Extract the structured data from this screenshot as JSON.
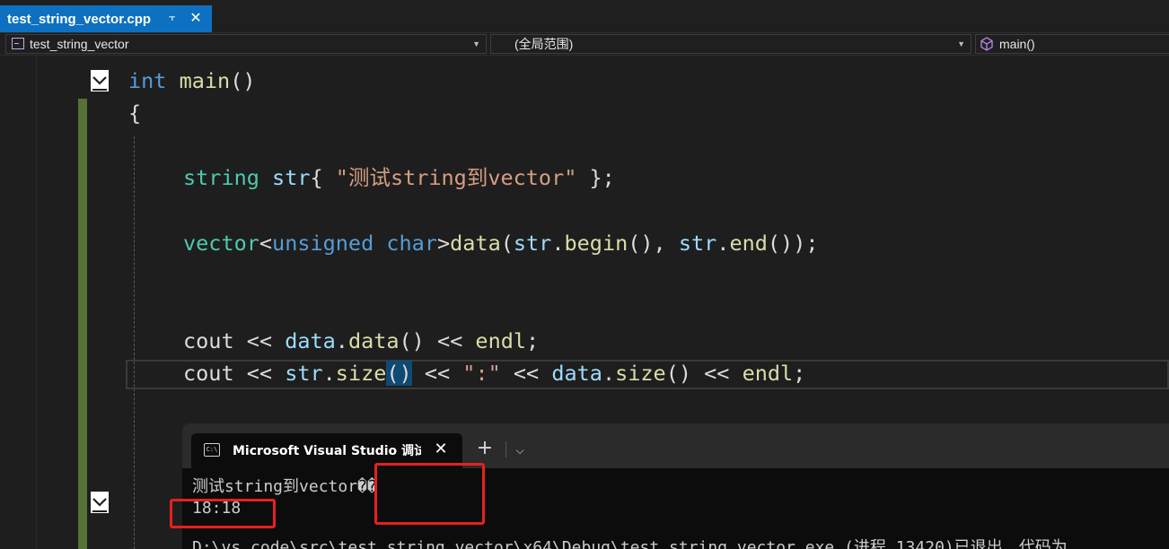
{
  "tab": {
    "title": "test_string_vector.cpp",
    "pin_icon": "pin-icon",
    "close_icon": "close-icon",
    "active_color": "#0e70c0"
  },
  "navbar": {
    "project": "test_string_vector",
    "scope": "(全局范围)",
    "member": "main()"
  },
  "code": {
    "line_main": {
      "kw": "int",
      "fn": "main",
      "rest": "()"
    },
    "line_open": "{",
    "line_str": {
      "type": "string",
      "var": "str",
      "open": "{ ",
      "literal": "\"测试string到vector\"",
      "close": " };"
    },
    "line_vec": {
      "type": "vector",
      "lt": "<",
      "kw1": "unsigned",
      "kw2": "char",
      "gt": ">",
      "fn": "data",
      "p1": "(",
      "v1": "str",
      "dot1": ".",
      "f1": "begin",
      "c1": "(), ",
      "v2": "str",
      "dot2": ".",
      "f2": "end",
      "c2": "());"
    },
    "line_cout1": {
      "a": "cout",
      "op1": " << ",
      "v": "data",
      "dot": ".",
      "f": "data",
      "c": "()",
      "op2": " << ",
      "e": "endl",
      "semi": ";"
    },
    "line_cout2": {
      "a": "cout",
      "op1": " << ",
      "v1": "str",
      "dot1": ".",
      "f1": "size",
      "p_open": "(",
      "p_close": ")",
      "op2": " << ",
      "lit": "\":\"",
      "op3": " << ",
      "v2": "data",
      "dot2": ".",
      "f2": "size",
      "c2": "()",
      "op4": " << ",
      "e": "endl",
      "semi": ";"
    }
  },
  "terminal": {
    "tab_title": "Microsoft Visual Studio 调试控制台",
    "tab_icon": "console-icon",
    "close_icon": "close-icon",
    "new_tab_icon": "plus-icon",
    "dropdown_icon": "chevron-down-icon",
    "output": [
      "测试string到vector��",
      "18:18",
      "D:\\vs_code\\src\\test_string_vector\\x64\\Debug\\test_string_vector.exe (进程 13420)已退出，代码为"
    ]
  },
  "colors": {
    "annotation_red": "#e8201c",
    "change_bar_green": "#557135",
    "editor_bg": "#1e1e1e"
  }
}
